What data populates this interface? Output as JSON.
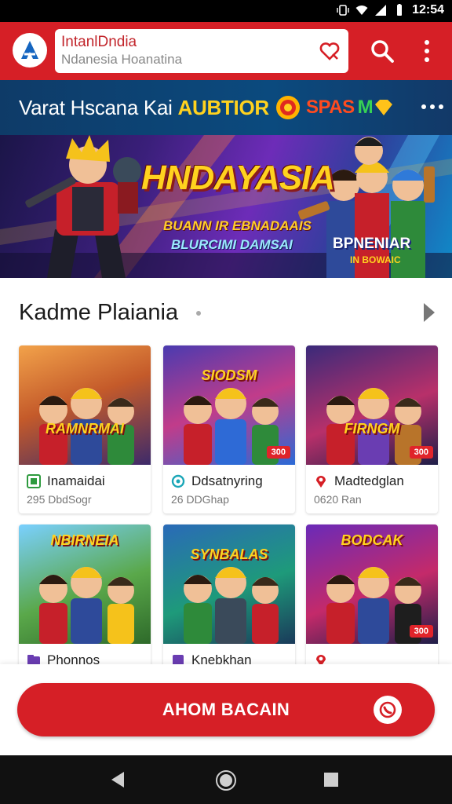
{
  "status_bar": {
    "time": "12:54"
  },
  "app_bar": {
    "search_title": "IntanlDndia",
    "search_subtitle": "Ndanesia Hoanatina"
  },
  "promo": {
    "text": "Varat Hscana Kai ",
    "highlight": "AUBTIOR",
    "badge_text": "SPAS",
    "badge_m": "M"
  },
  "hero": {
    "title": "HNDAYASIA",
    "line1": "BUANN IR EBNADAAIS",
    "line2": "BLURCIMI DAMSAI",
    "side_line1": "BPNENIAR",
    "side_line2": "IN BOWAIC"
  },
  "section": {
    "title": "Kadme Plaiania"
  },
  "cards": [
    {
      "art_title": "RAMNRMAI",
      "name": "Inamaidai",
      "info": "295 DbdSogr",
      "price": "",
      "icon": "grid-icon",
      "icon_color": "#2e9b3f"
    },
    {
      "art_title": "SIODSM",
      "name": "Ddsatnyring",
      "info": "26 DDGhap",
      "price": "300",
      "icon": "circle-icon",
      "icon_color": "#1aa6b7"
    },
    {
      "art_title": "FIRNGM",
      "name": "Madtedglan",
      "info": "0620 Ran",
      "price": "300",
      "icon": "pin-icon",
      "icon_color": "#d61f26"
    },
    {
      "art_title": "NBIRNEIA",
      "name": "Phonnos",
      "info": "",
      "price": "",
      "icon": "folder-icon",
      "icon_color": "#6a3db2"
    },
    {
      "art_title": "SYNBALAS",
      "name": "Knebkhan",
      "info": "",
      "price": "",
      "icon": "square-icon",
      "icon_color": "#6a3db2"
    },
    {
      "art_title": "BODCAK",
      "name": "",
      "info": "",
      "price": "300",
      "icon": "pin-icon",
      "icon_color": "#d61f26"
    }
  ],
  "action": {
    "label": "AHOM BACAIN"
  },
  "colors": {
    "primary": "#d61f26",
    "promo_bg": "#0e3b68",
    "accent": "#ffd21f"
  }
}
